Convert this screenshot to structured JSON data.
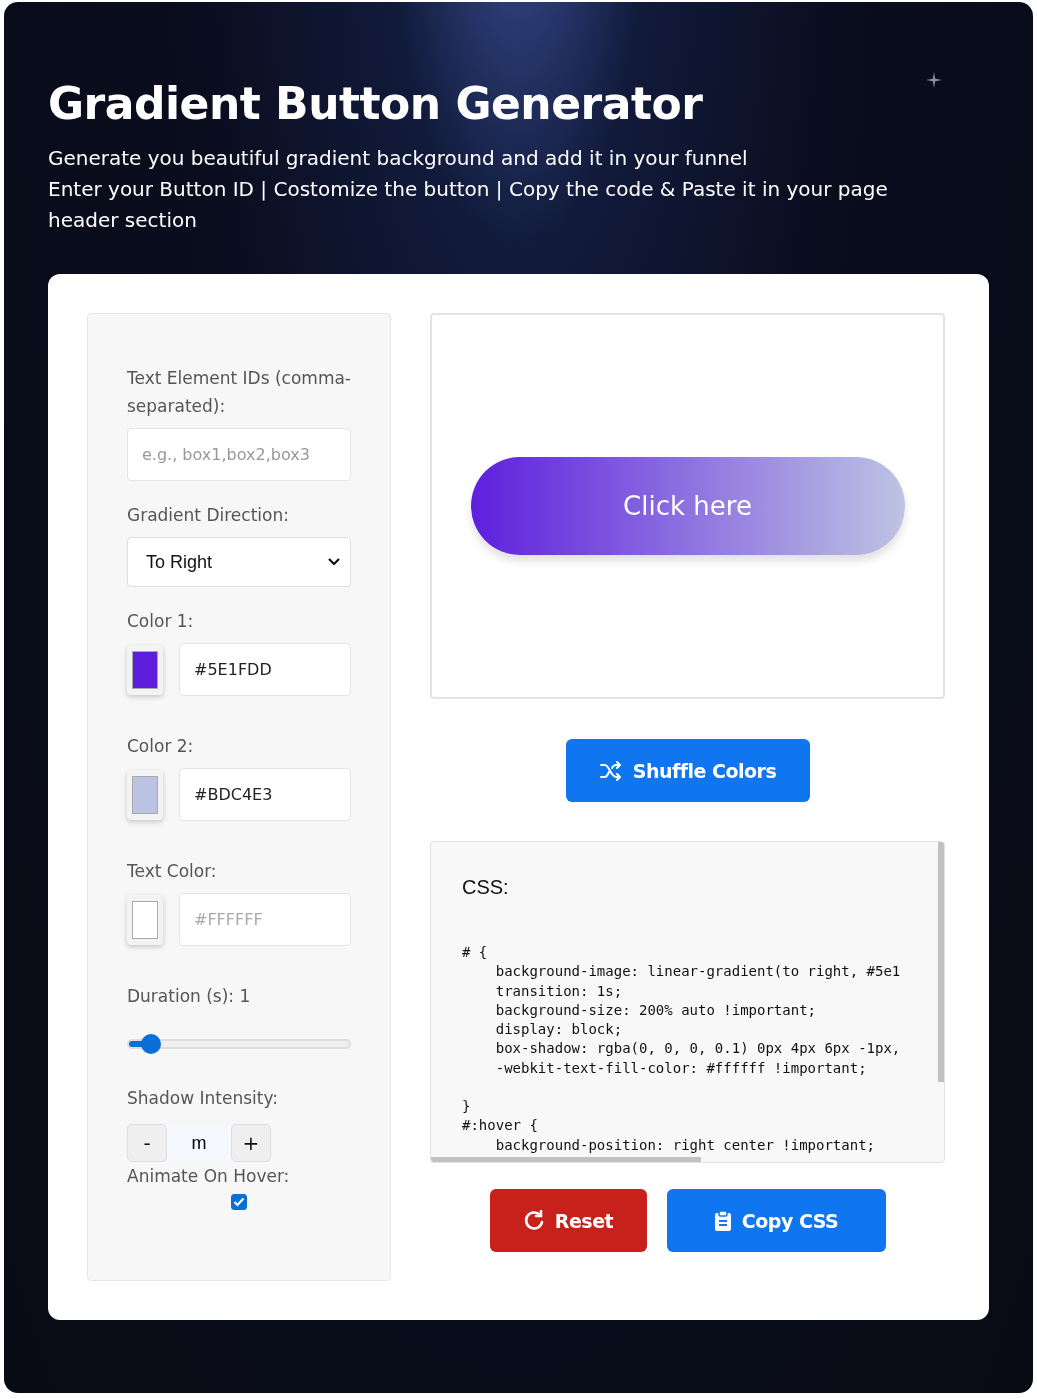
{
  "header": {
    "title": "Gradient Button Generator",
    "lines": [
      "Generate you beautiful gradient background and add it in your funnel",
      "Enter your Button ID | Costomize the button | Copy the code & Paste it in your page header section"
    ]
  },
  "form": {
    "ids": {
      "label": "Text Element IDs (comma-separated):",
      "placeholder": "e.g., box1,box2,box3"
    },
    "direction": {
      "label": "Gradient Direction:",
      "value": "To Right"
    },
    "colors": [
      {
        "label": "Color 1:",
        "value": "#5E1FDD",
        "color": "#5e1fdd"
      },
      {
        "label": "Color 2:",
        "value": "#BDC4E3",
        "color": "#bdc4e3"
      },
      {
        "label": "Text Color:",
        "placeholder": "#FFFFFF",
        "color": "#ffffff"
      }
    ],
    "duration": {
      "label": "Duration (s): 1",
      "level": 0.1
    },
    "shadow": {
      "label": "Shadow Intensity:",
      "minus": "-",
      "value": "m",
      "plus": "+"
    },
    "animate": {
      "label": "Animate On Hover:",
      "checked": true
    }
  },
  "preview": {
    "label": "Click here"
  },
  "shuffle": {
    "label": "Shuffle Colors"
  },
  "code": {
    "heading": "CSS:",
    "lines": [
      "# {",
      "    background-image: linear-gradient(to right, #5e1",
      "    transition: 1s;",
      "    background-size: 200% auto !important;",
      "    display: block;",
      "    box-shadow: rgba(0, 0, 0, 0.1) 0px 4px 6px -1px,",
      "    -webkit-text-fill-color: #ffffff !important;"
    ],
    "hover_lines": [
      "}",
      "#:hover {",
      "    background-position: right center !important;"
    ]
  },
  "actions": [
    {
      "kind": "reset",
      "label": "Reset"
    },
    {
      "kind": "copy",
      "label": "Copy CSS"
    }
  ]
}
